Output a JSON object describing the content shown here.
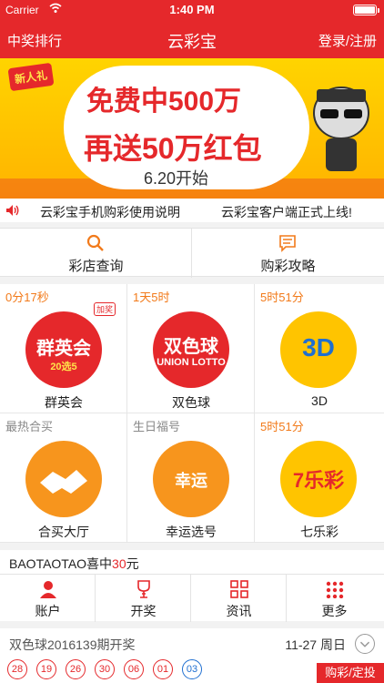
{
  "status": {
    "carrier": "Carrier",
    "time": "1:40 PM"
  },
  "nav": {
    "left": "中奖排行",
    "title": "云彩宝",
    "right": "登录/注册"
  },
  "banner": {
    "tag": "新人礼",
    "line1": "免费中500万",
    "line2": "再送50万红包",
    "line3": "6.20开始"
  },
  "notice": {
    "item1": "云彩宝手机购彩使用说明",
    "item2": "云彩宝客户端正式上线!"
  },
  "quick": [
    {
      "label": "彩店查询",
      "icon": "search-icon"
    },
    {
      "label": "购彩攻略",
      "icon": "message-icon"
    }
  ],
  "tiles": [
    {
      "timer": "0分17秒",
      "name": "群英会",
      "logo": "群英会",
      "badge": "加奖"
    },
    {
      "timer": "1天5时",
      "name": "双色球",
      "logo": "双色球"
    },
    {
      "timer": "5时51分",
      "name": "3D",
      "logo": "3D"
    },
    {
      "timer": "最热合买",
      "name": "合买大厅",
      "logo": ""
    },
    {
      "timer": "生日福号",
      "name": "幸运选号",
      "logo": "幸运"
    },
    {
      "timer": "5时51分",
      "name": "七乐彩",
      "logo": "7乐彩"
    }
  ],
  "winner": {
    "user": "BAOTAOTAO",
    "text": "喜中",
    "amount": "30",
    "unit": "元"
  },
  "tabs": [
    {
      "label": "账户",
      "icon": "person-icon"
    },
    {
      "label": "开奖",
      "icon": "trophy-icon"
    },
    {
      "label": "资讯",
      "icon": "grid-icon"
    },
    {
      "label": "更多",
      "icon": "dots-icon"
    }
  ],
  "draw": {
    "title": "双色球2016139期开奖",
    "date": "11-27 周日",
    "red_balls": [
      "28",
      "19",
      "26",
      "30",
      "06",
      "01"
    ],
    "blue_balls": [
      "03"
    ],
    "buy_label": "购彩/定投"
  },
  "colors": {
    "brand_red": "#e5282b",
    "timer_orange": "#f27a1a",
    "blue_ball": "#1f6fd1"
  }
}
